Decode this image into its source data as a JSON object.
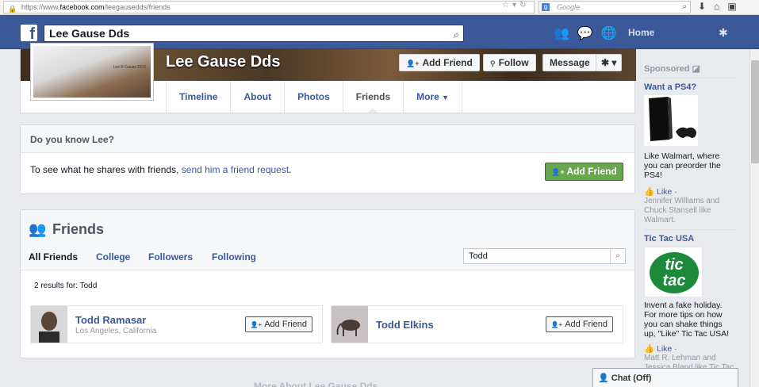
{
  "browser": {
    "url_prefix": "https://www.",
    "url_domain": "facebook.com",
    "url_path": "/leegausedds/friends",
    "search_placeholder": "Google"
  },
  "fb_header": {
    "search_value": "Lee Gause Dds",
    "home_label": "Home"
  },
  "profile": {
    "name": "Lee Gause Dds",
    "pic_text": "Lee R Gause DDS",
    "buttons": {
      "add_friend": "Add Friend",
      "follow": "Follow",
      "message": "Message"
    },
    "tabs": [
      {
        "label": "Timeline"
      },
      {
        "label": "About"
      },
      {
        "label": "Photos"
      },
      {
        "label": "Friends"
      },
      {
        "label": "More"
      }
    ]
  },
  "know": {
    "heading": "Do you know Lee?",
    "text": "To see what he shares with friends, ",
    "link": "send him a friend request",
    "period": ".",
    "button": "Add Friend"
  },
  "friends": {
    "title": "Friends",
    "tabs": [
      "All Friends",
      "College",
      "Followers",
      "Following"
    ],
    "search_value": "Todd",
    "results_text": "2 results for: Todd",
    "cards": [
      {
        "name": "Todd Ramasar",
        "location": "Los Angeles, California",
        "button": "Add Friend"
      },
      {
        "name": "Todd Elkins",
        "button": "Add Friend"
      }
    ],
    "faded_footer": "More About Lee Gause Dds"
  },
  "sidebar": {
    "sponsored": "Sponsored",
    "ads": [
      {
        "title": "Want a PS4?",
        "text": "Like Walmart, where you can preorder the PS4!",
        "like": "Like",
        "social": "Jennifer Williams and Chuck Stansell like Walmart."
      },
      {
        "title": "Tic Tac USA",
        "logo_line1": "tic",
        "logo_line2": "tac",
        "text": "Invent a fake holiday. For more tips on how you can shake things up, \"Like\" Tic Tac USA!",
        "like": "Like",
        "social": "Matt R. Lehman and Jessica Bland like Tic Tac USA."
      }
    ]
  },
  "chat": {
    "label": "Chat (Off)"
  },
  "colors": {
    "fb_blue": "#3b5998",
    "green_button": "#69a74e"
  }
}
